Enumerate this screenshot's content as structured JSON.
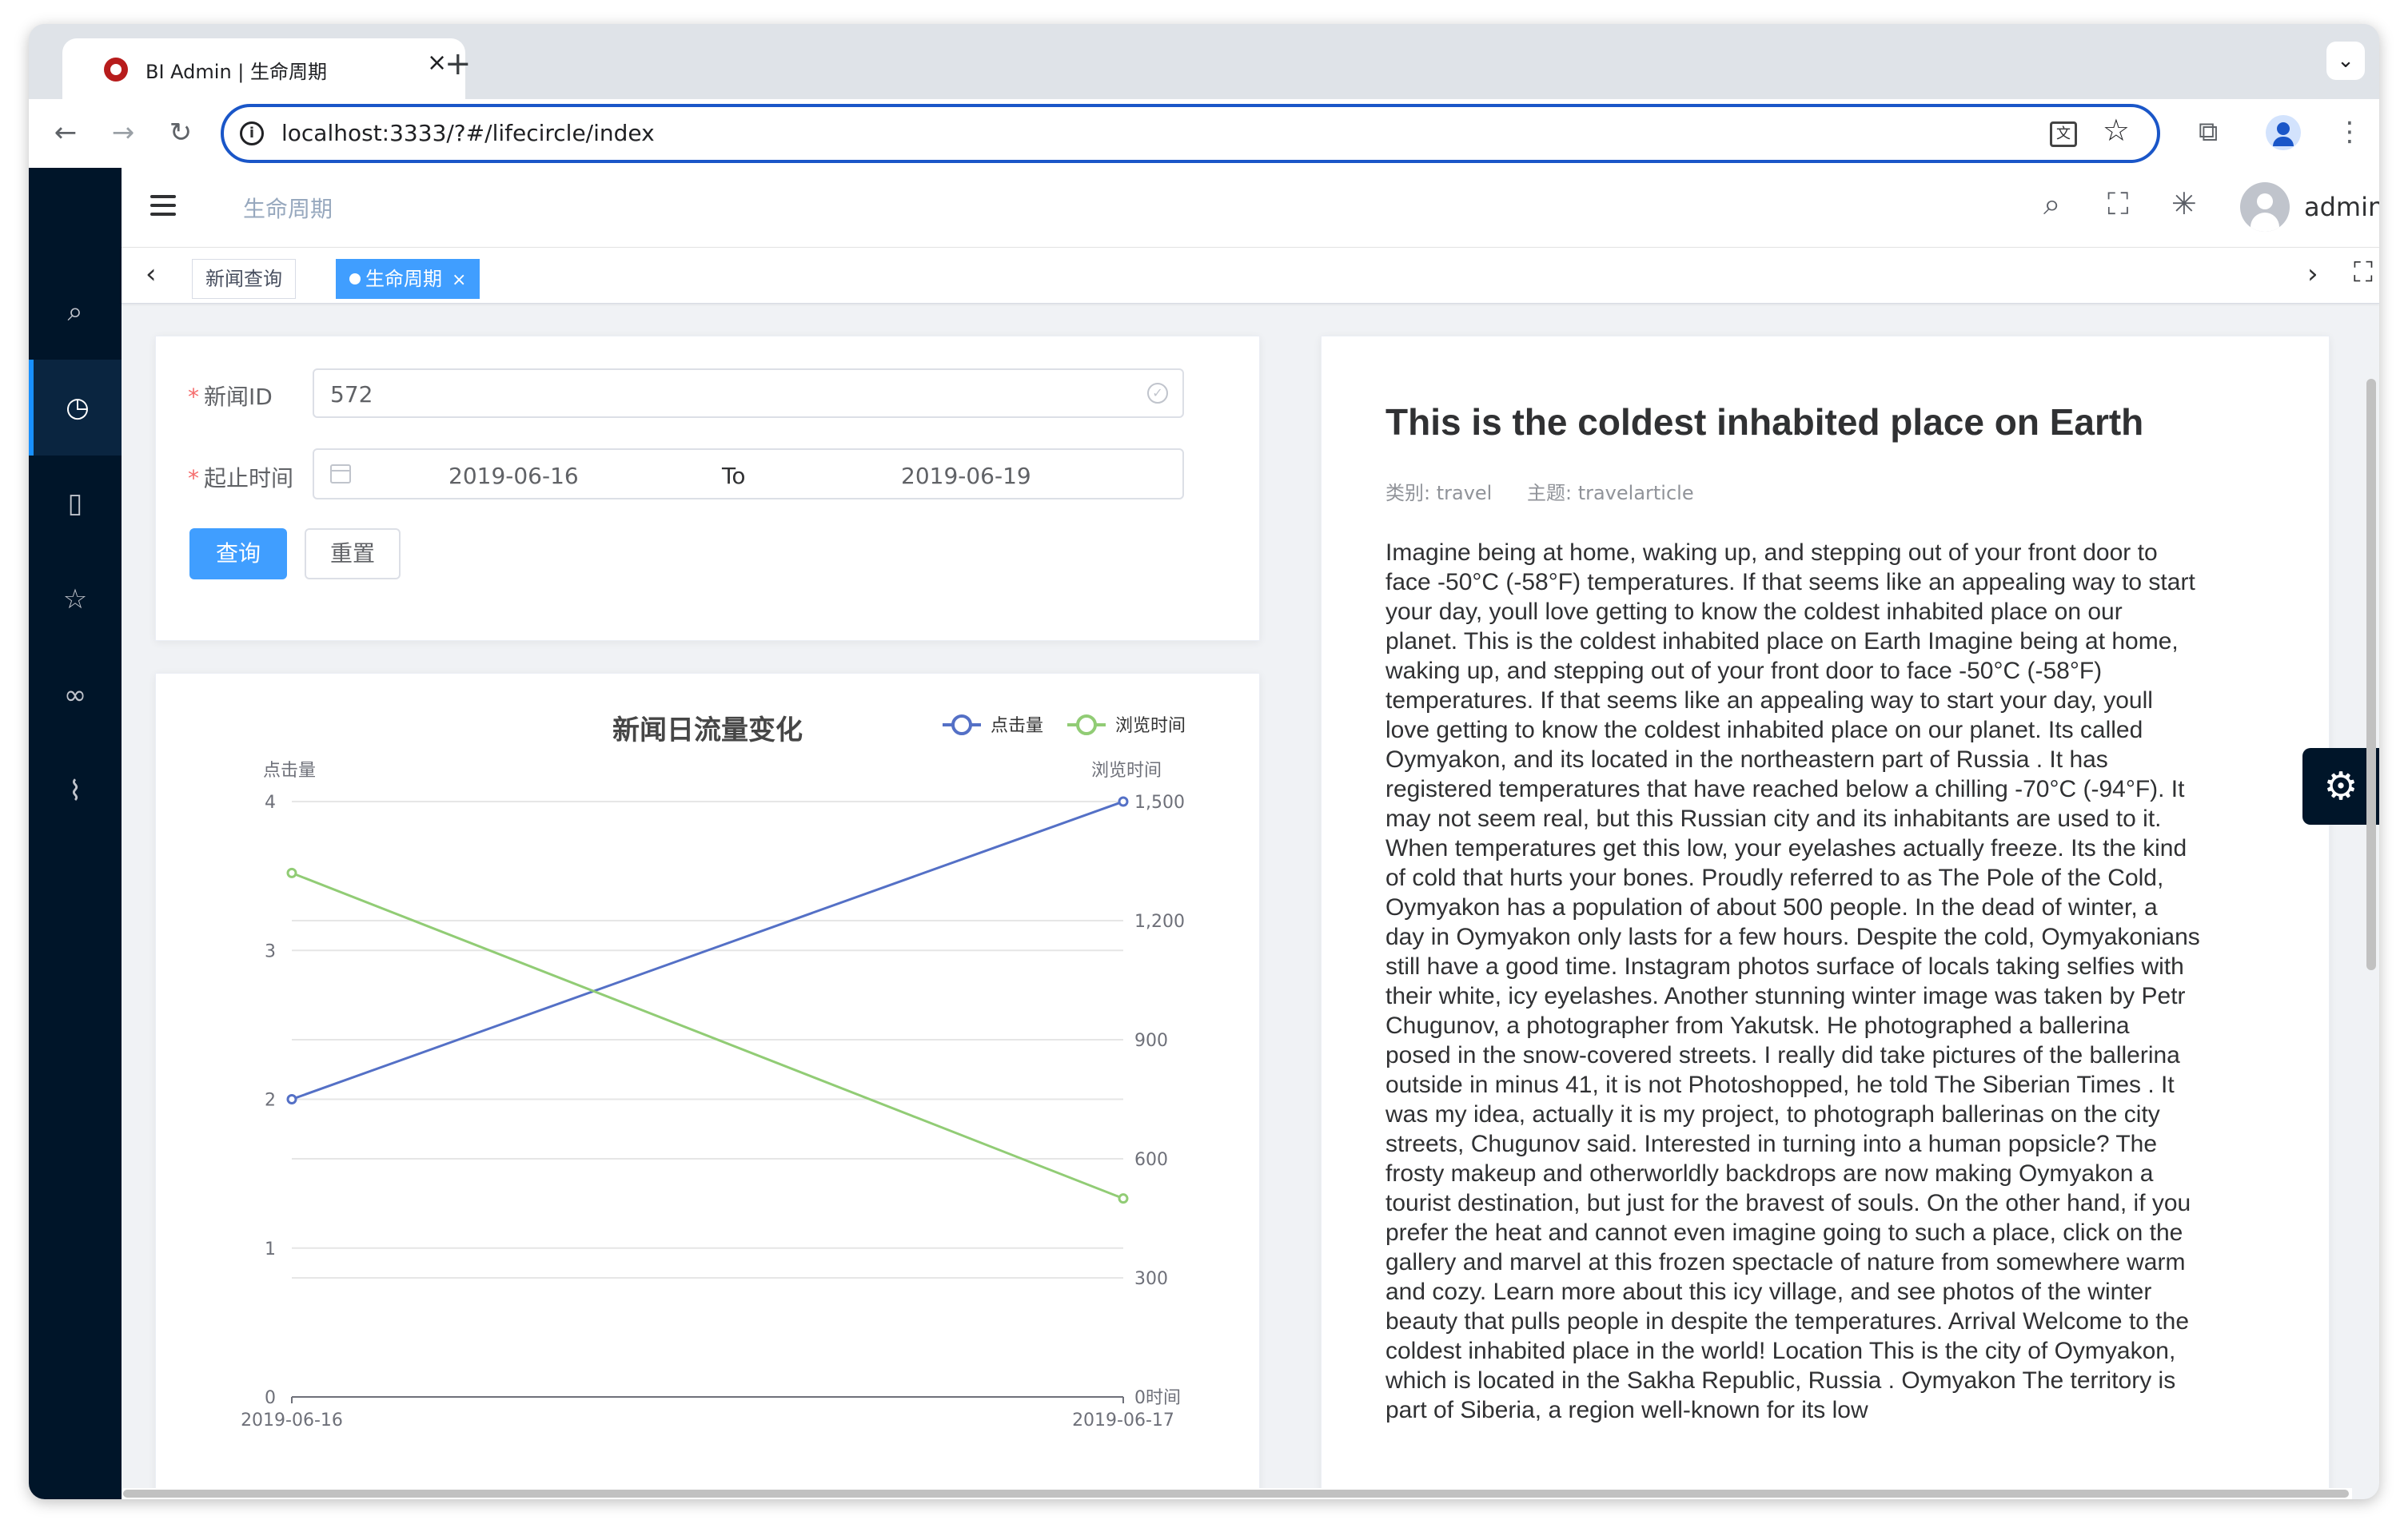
{
  "browser": {
    "tab_title": "BI Admin | 生命周期",
    "tab_close": "×",
    "new_tab": "+",
    "tabs_menu": "⌄",
    "url": "localhost:3333/?#/lifecircle/index",
    "site_info": "i",
    "translate": "文",
    "star": "☆"
  },
  "sidebar": {
    "items": [
      {
        "icon": "search-icon",
        "glyph": "⌕",
        "active": false
      },
      {
        "icon": "clock-icon",
        "glyph": "◷",
        "active": true
      },
      {
        "icon": "book-icon",
        "glyph": "▯",
        "active": false
      },
      {
        "icon": "star-icon",
        "glyph": "☆",
        "active": false
      },
      {
        "icon": "link-icon",
        "glyph": "∞",
        "active": false
      },
      {
        "icon": "paperclip-icon",
        "glyph": "⌇",
        "active": false
      }
    ]
  },
  "navbar": {
    "breadcrumb": "生命周期",
    "search_icon": "⌕",
    "fullscreen_icon": "⛶",
    "size_icon": "✳",
    "username": "admin"
  },
  "tags": [
    {
      "label": "新闻查询",
      "active": false
    },
    {
      "label": "生命周期",
      "active": true,
      "close": "×"
    }
  ],
  "tags_nav": {
    "prev": "‹",
    "next": "›",
    "full": "⛶"
  },
  "form": {
    "id_label": "新闻ID",
    "id_value": "572",
    "id_check": "✓",
    "range_label": "起止时间",
    "start_date": "2019-06-16",
    "range_separator": "To",
    "end_date": "2019-06-19",
    "query_button": "查询",
    "reset_button": "重置",
    "required_mark": "*"
  },
  "chart_data": {
    "type": "line",
    "title": "新闻日流量变化",
    "x": [
      "2019-06-16",
      "2019-06-17"
    ],
    "series": [
      {
        "name": "点击量",
        "axis": "left",
        "values": [
          2,
          4
        ],
        "color": "#5470c6"
      },
      {
        "name": "浏览时间",
        "axis": "right",
        "values": [
          1320,
          500
        ],
        "color": "#91cc75"
      }
    ],
    "y_left": {
      "label": "点击量",
      "min": 0,
      "max": 4,
      "ticks": [
        "0",
        "1",
        "2",
        "3",
        "4"
      ]
    },
    "y_right": {
      "label": "浏览时间",
      "min": 0,
      "max": 1500,
      "ticks": [
        "0时间",
        "300",
        "600",
        "900",
        "1,200",
        "1,500"
      ]
    },
    "legend_position": "top-right",
    "grid": true
  },
  "article": {
    "title": "This is the coldest inhabited place on Earth",
    "category": "类别: travel",
    "topic": "主题: travelarticle",
    "body": "Imagine being at home, waking up, and stepping out of your front door to face -50°C (-58°F) temperatures. If that seems like an appealing way to start your day, youll love getting to know the coldest inhabited place on our planet. This is the coldest inhabited place on Earth Imagine being at home, waking up, and stepping out of your front door to face -50°C (-58°F) temperatures. If that seems like an appealing way to start your day, youll love getting to know the coldest inhabited place on our planet. Its called Oymyakon, and its located in the northeastern part of Russia . It has registered temperatures that have reached below a chilling -70°C (-94°F). It may not seem real, but this Russian city and its inhabitants are used to it. When temperatures get this low, your eyelashes actually freeze. Its the kind of cold that hurts your bones. Proudly referred to as The Pole of the Cold, Oymyakon has a population of about 500 people. In the dead of winter, a day in Oymyakon only lasts for a few hours. Despite the cold, Oymyakonians still have a good time. Instagram photos surface of locals taking selfies with their white, icy eyelashes. Another stunning winter image was taken by Petr Chugunov, a photographer from Yakutsk. He photographed a ballerina posed in the snow-covered streets. I really did take pictures of the ballerina outside in minus 41, it is not Photoshopped, he told The Siberian Times . It was my idea, actually it is my project, to photograph ballerinas on the city streets, Chugunov said. Interested in turning into a human popsicle? The frosty makeup and otherworldly backdrops are now making Oymyakon a tourist destination, but just for the bravest of souls. On the other hand, if you prefer the heat and cannot even imagine going to such a place, click on the gallery and marvel at this frozen spectacle of nature from somewhere warm and cozy. Learn more about this icy village, and see photos of the winter beauty that pulls people in despite the temperatures. Arrival Welcome to the coldest inhabited place in the world! Location This is the city of Oymyakon, which is located in the Sakha Republic, Russia . Oymyakon The territory is part of Siberia, a region well-known for its low"
  },
  "settings_fab": "⚙"
}
